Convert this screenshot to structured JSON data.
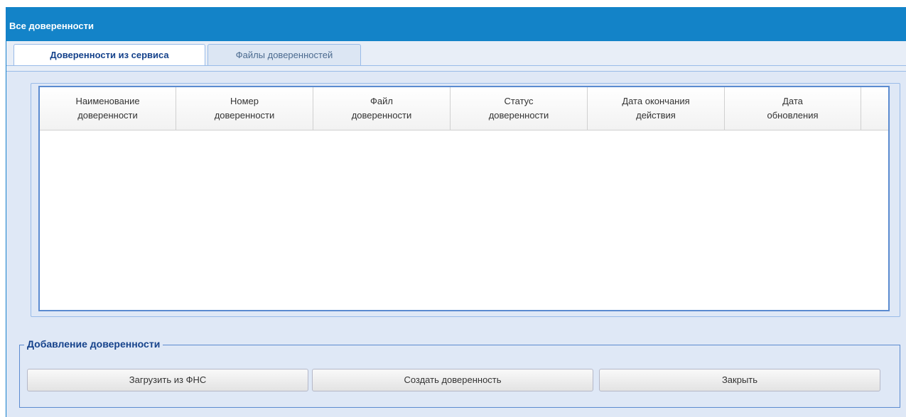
{
  "window": {
    "title": "Все доверенности"
  },
  "tabs": [
    {
      "label": "Доверенности из сервиса",
      "active": true
    },
    {
      "label": "Файлы доверенностей",
      "active": false
    }
  ],
  "grid": {
    "columns": [
      "Наименование\nдоверенности",
      "Номер\nдоверенности",
      "Файл\nдоверенности",
      "Статус\nдоверенности",
      "Дата окончания\nдействия",
      "Дата\nобновления"
    ],
    "rows": []
  },
  "add_section": {
    "legend": "Добавление доверенности",
    "buttons": {
      "load_fns": "Загрузить из ФНС",
      "create": "Создать доверенность",
      "close": "Закрыть"
    }
  },
  "colors": {
    "title_bar": "#1383c8",
    "panel_bg": "#dfe8f6",
    "accent": "#15428b"
  }
}
